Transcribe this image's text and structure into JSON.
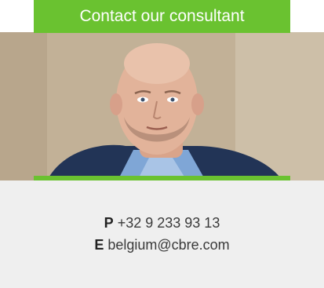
{
  "banner": {
    "title": "Contact our consultant"
  },
  "photo": {
    "subject": "consultant-portrait"
  },
  "contact": {
    "phone_label": "P",
    "phone_value": "+32 9 233 93 13",
    "email_label": "E",
    "email_value": "belgium@cbre.com"
  },
  "colors": {
    "accent": "#6ac230",
    "card_bg": "#efefef",
    "text": "#3a3a3a"
  }
}
